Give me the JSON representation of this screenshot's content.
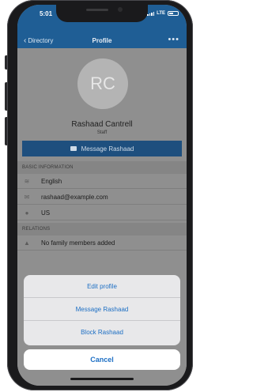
{
  "status": {
    "time": "5:01",
    "network": "LTE"
  },
  "nav": {
    "back_label": "Directory",
    "title": "Profile",
    "more_label": "•••"
  },
  "profile": {
    "initials": "RC",
    "name": "Rashaad Cantrell",
    "role": "Staff",
    "message_button": "Message Rashaad"
  },
  "basic_info": {
    "header": "BASIC INFORMATION",
    "rows": [
      {
        "icon": "language-icon",
        "value": "English"
      },
      {
        "icon": "mail-icon",
        "value": "rashaad@example.com"
      },
      {
        "icon": "location-pin-icon",
        "value": "US"
      }
    ]
  },
  "relations": {
    "header": "RELATIONS",
    "rows": [
      {
        "icon": "person-icon",
        "value": "No family members added"
      }
    ]
  },
  "action_sheet": {
    "items": [
      "Edit profile",
      "Message Rashaad",
      "Block Rashaad"
    ],
    "cancel": "Cancel"
  },
  "colors": {
    "accent": "#1d6fc4",
    "nav_bg": "#1f5e95"
  }
}
